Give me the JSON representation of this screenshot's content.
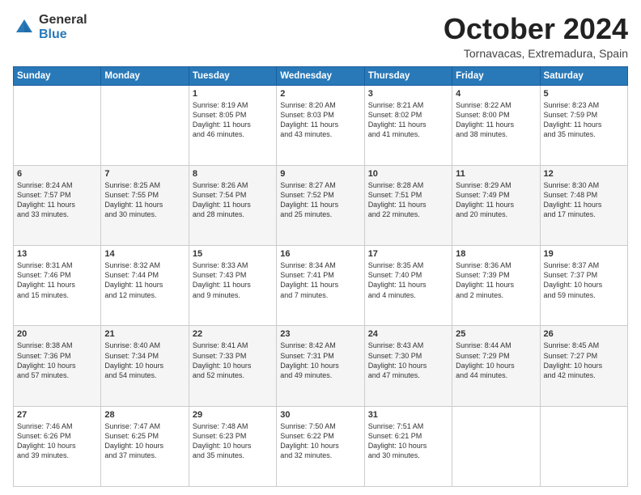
{
  "logo": {
    "general": "General",
    "blue": "Blue"
  },
  "title": "October 2024",
  "subtitle": "Tornavacas, Extremadura, Spain",
  "days_of_week": [
    "Sunday",
    "Monday",
    "Tuesday",
    "Wednesday",
    "Thursday",
    "Friday",
    "Saturday"
  ],
  "weeks": [
    [
      {
        "day": "",
        "content": ""
      },
      {
        "day": "",
        "content": ""
      },
      {
        "day": "1",
        "content": "Sunrise: 8:19 AM\nSunset: 8:05 PM\nDaylight: 11 hours\nand 46 minutes."
      },
      {
        "day": "2",
        "content": "Sunrise: 8:20 AM\nSunset: 8:03 PM\nDaylight: 11 hours\nand 43 minutes."
      },
      {
        "day": "3",
        "content": "Sunrise: 8:21 AM\nSunset: 8:02 PM\nDaylight: 11 hours\nand 41 minutes."
      },
      {
        "day": "4",
        "content": "Sunrise: 8:22 AM\nSunset: 8:00 PM\nDaylight: 11 hours\nand 38 minutes."
      },
      {
        "day": "5",
        "content": "Sunrise: 8:23 AM\nSunset: 7:59 PM\nDaylight: 11 hours\nand 35 minutes."
      }
    ],
    [
      {
        "day": "6",
        "content": "Sunrise: 8:24 AM\nSunset: 7:57 PM\nDaylight: 11 hours\nand 33 minutes."
      },
      {
        "day": "7",
        "content": "Sunrise: 8:25 AM\nSunset: 7:55 PM\nDaylight: 11 hours\nand 30 minutes."
      },
      {
        "day": "8",
        "content": "Sunrise: 8:26 AM\nSunset: 7:54 PM\nDaylight: 11 hours\nand 28 minutes."
      },
      {
        "day": "9",
        "content": "Sunrise: 8:27 AM\nSunset: 7:52 PM\nDaylight: 11 hours\nand 25 minutes."
      },
      {
        "day": "10",
        "content": "Sunrise: 8:28 AM\nSunset: 7:51 PM\nDaylight: 11 hours\nand 22 minutes."
      },
      {
        "day": "11",
        "content": "Sunrise: 8:29 AM\nSunset: 7:49 PM\nDaylight: 11 hours\nand 20 minutes."
      },
      {
        "day": "12",
        "content": "Sunrise: 8:30 AM\nSunset: 7:48 PM\nDaylight: 11 hours\nand 17 minutes."
      }
    ],
    [
      {
        "day": "13",
        "content": "Sunrise: 8:31 AM\nSunset: 7:46 PM\nDaylight: 11 hours\nand 15 minutes."
      },
      {
        "day": "14",
        "content": "Sunrise: 8:32 AM\nSunset: 7:44 PM\nDaylight: 11 hours\nand 12 minutes."
      },
      {
        "day": "15",
        "content": "Sunrise: 8:33 AM\nSunset: 7:43 PM\nDaylight: 11 hours\nand 9 minutes."
      },
      {
        "day": "16",
        "content": "Sunrise: 8:34 AM\nSunset: 7:41 PM\nDaylight: 11 hours\nand 7 minutes."
      },
      {
        "day": "17",
        "content": "Sunrise: 8:35 AM\nSunset: 7:40 PM\nDaylight: 11 hours\nand 4 minutes."
      },
      {
        "day": "18",
        "content": "Sunrise: 8:36 AM\nSunset: 7:39 PM\nDaylight: 11 hours\nand 2 minutes."
      },
      {
        "day": "19",
        "content": "Sunrise: 8:37 AM\nSunset: 7:37 PM\nDaylight: 10 hours\nand 59 minutes."
      }
    ],
    [
      {
        "day": "20",
        "content": "Sunrise: 8:38 AM\nSunset: 7:36 PM\nDaylight: 10 hours\nand 57 minutes."
      },
      {
        "day": "21",
        "content": "Sunrise: 8:40 AM\nSunset: 7:34 PM\nDaylight: 10 hours\nand 54 minutes."
      },
      {
        "day": "22",
        "content": "Sunrise: 8:41 AM\nSunset: 7:33 PM\nDaylight: 10 hours\nand 52 minutes."
      },
      {
        "day": "23",
        "content": "Sunrise: 8:42 AM\nSunset: 7:31 PM\nDaylight: 10 hours\nand 49 minutes."
      },
      {
        "day": "24",
        "content": "Sunrise: 8:43 AM\nSunset: 7:30 PM\nDaylight: 10 hours\nand 47 minutes."
      },
      {
        "day": "25",
        "content": "Sunrise: 8:44 AM\nSunset: 7:29 PM\nDaylight: 10 hours\nand 44 minutes."
      },
      {
        "day": "26",
        "content": "Sunrise: 8:45 AM\nSunset: 7:27 PM\nDaylight: 10 hours\nand 42 minutes."
      }
    ],
    [
      {
        "day": "27",
        "content": "Sunrise: 7:46 AM\nSunset: 6:26 PM\nDaylight: 10 hours\nand 39 minutes."
      },
      {
        "day": "28",
        "content": "Sunrise: 7:47 AM\nSunset: 6:25 PM\nDaylight: 10 hours\nand 37 minutes."
      },
      {
        "day": "29",
        "content": "Sunrise: 7:48 AM\nSunset: 6:23 PM\nDaylight: 10 hours\nand 35 minutes."
      },
      {
        "day": "30",
        "content": "Sunrise: 7:50 AM\nSunset: 6:22 PM\nDaylight: 10 hours\nand 32 minutes."
      },
      {
        "day": "31",
        "content": "Sunrise: 7:51 AM\nSunset: 6:21 PM\nDaylight: 10 hours\nand 30 minutes."
      },
      {
        "day": "",
        "content": ""
      },
      {
        "day": "",
        "content": ""
      }
    ]
  ]
}
